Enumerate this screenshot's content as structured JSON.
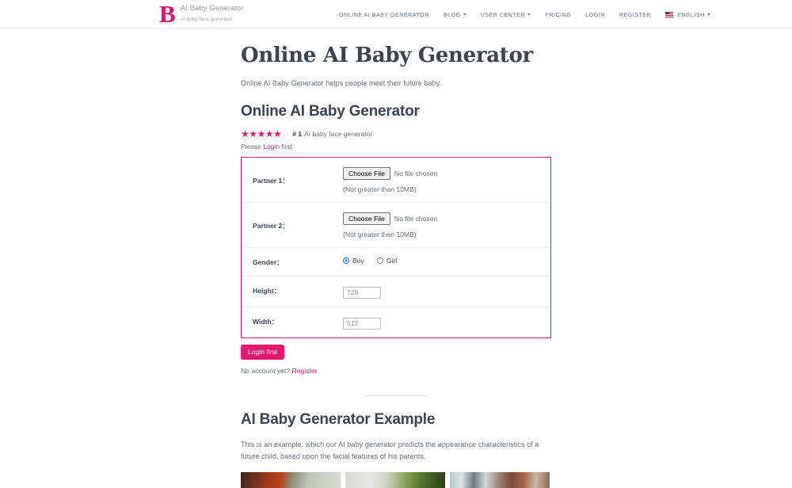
{
  "header": {
    "brand": {
      "logo_letter": "B",
      "title": "AI Baby Generator",
      "subtitle": "AI baby face generator"
    },
    "nav": [
      {
        "label": "ONLINE AI BABY GENERATOR",
        "has_caret": false,
        "has_flag": false
      },
      {
        "label": "BLOG",
        "has_caret": true,
        "has_flag": false
      },
      {
        "label": "USER CENTER",
        "has_caret": true,
        "has_flag": false
      },
      {
        "label": "PRICING",
        "has_caret": false,
        "has_flag": false
      },
      {
        "label": "LOGIN",
        "has_caret": false,
        "has_flag": false
      },
      {
        "label": "REGISTER",
        "has_caret": false,
        "has_flag": false
      },
      {
        "label": "ENGLISH",
        "has_caret": true,
        "has_flag": true
      }
    ]
  },
  "main": {
    "page_title": "Online AI Baby Generator",
    "page_description": "Online AI Baby Generator helps people meet their future baby.",
    "section_title": "Online AI Baby Generator",
    "rating": {
      "stars": "★★★★★",
      "star_count": 5,
      "rank": "# 1",
      "rank_label": "AI baby face generator"
    },
    "login_note_prefix": "Please ",
    "login_link": "Login",
    "login_note_suffix": " first"
  },
  "form": {
    "partner1": {
      "label": "Partner 1：",
      "button": "Choose File",
      "file_status": "No file chosen",
      "hint": "(Not greater than 10MB)"
    },
    "partner2": {
      "label": "Partner 2：",
      "button": "Choose File",
      "file_status": "No file chosen",
      "hint": "(Not greater than 10MB)"
    },
    "gender": {
      "label": "Gender：",
      "options": [
        {
          "label": "Boy",
          "selected": true
        },
        {
          "label": "Girl",
          "selected": false
        }
      ]
    },
    "height": {
      "label": "Height：",
      "value": "728"
    },
    "width": {
      "label": "Width：",
      "value": "512"
    },
    "submit_label": "Login first",
    "account_note_prefix": "No account yet? ",
    "register_link": "Register",
    "accent_color": "#e5176f",
    "border_color": "#d6186e"
  },
  "example": {
    "title": "AI Baby Generator Example",
    "description": "This is an example, which our AI baby generator predicts the appearance characteristics of a future child, based upon the facial features of his parents.",
    "thumbnails": [
      {
        "name": "example-image-1"
      },
      {
        "name": "example-image-2"
      },
      {
        "name": "example-image-3"
      }
    ]
  }
}
